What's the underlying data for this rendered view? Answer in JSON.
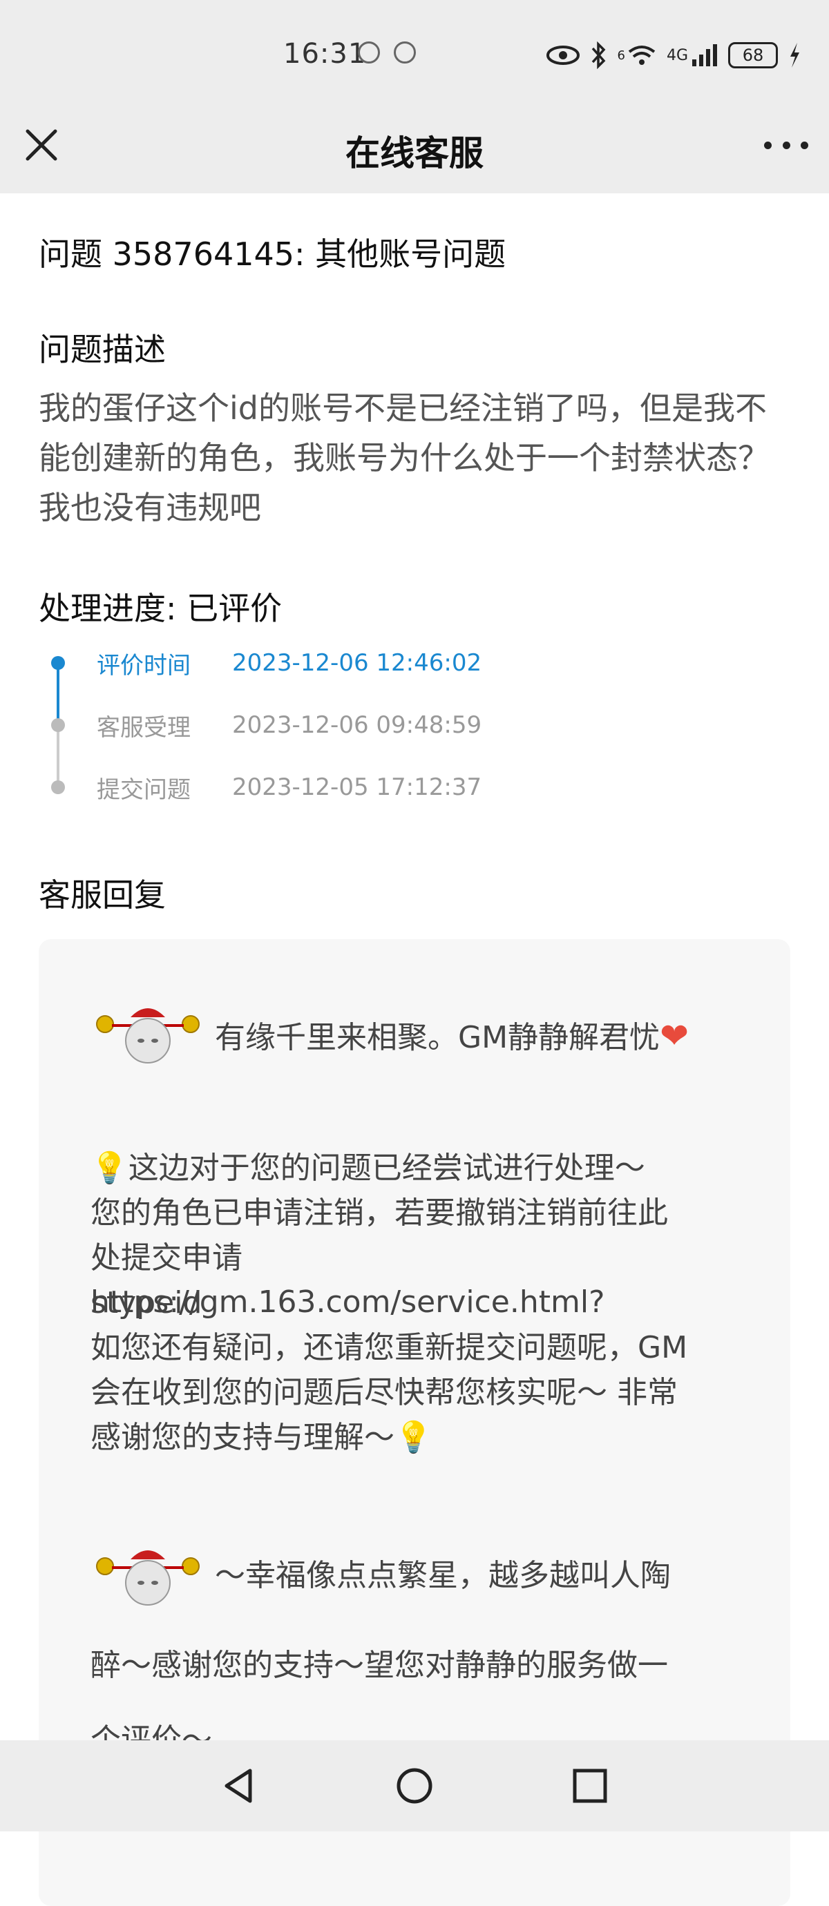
{
  "status_bar": {
    "time": "16:31",
    "network": "4G",
    "signal_extra": "6",
    "battery": "68"
  },
  "header": {
    "title": "在线客服"
  },
  "question": {
    "title": "问题 358764145:  其他账号问题"
  },
  "description": {
    "label": "问题描述",
    "text": "我的蛋仔这个id的账号不是已经注销了吗，但是我不能创建新的角色，我账号为什么处于一个封禁状态？我也没有违规吧"
  },
  "progress": {
    "label": "处理进度:  已评价",
    "timeline": [
      {
        "label": "评价时间",
        "time": "2023-12-06 12:46:02",
        "active": true
      },
      {
        "label": "客服受理",
        "time": "2023-12-06 09:48:59",
        "active": false
      },
      {
        "label": "提交问题",
        "time": "2023-12-05 17:12:37",
        "active": false
      }
    ]
  },
  "reply": {
    "label": "客服回复",
    "greeting": "有缘千里来相聚。GM静静解君忧",
    "body_line1": "这边对于您的问题已经尝试进行处理～",
    "body_line2": "您的角色已申请注销，若要撤销注销前往此",
    "body_line3": "处提交申请https://gm.163.com/service.html?",
    "body_line4": "stypeid",
    "body_line5": "如您还有疑问，还请您重新提交问题呢，GM",
    "body_line6": "会在收到您的问题后尽快帮您核实呢～ 非常",
    "body_line7": "感谢您的支持与理解～",
    "closing_line1": "～幸福像点点繁星，越多越叫人陶",
    "closing_line2": "醉～感谢您的支持～望您对静静的服务做一",
    "closing_line3": "个评价～"
  },
  "icons": {
    "close": "close-icon",
    "more": "more-icon",
    "nav_back": "back-triangle-icon",
    "nav_home": "home-circle-icon",
    "nav_recent": "recent-square-icon"
  },
  "colors": {
    "accent": "#1a88d0",
    "header_bg": "#ededed",
    "heart": "#e84b3c"
  }
}
